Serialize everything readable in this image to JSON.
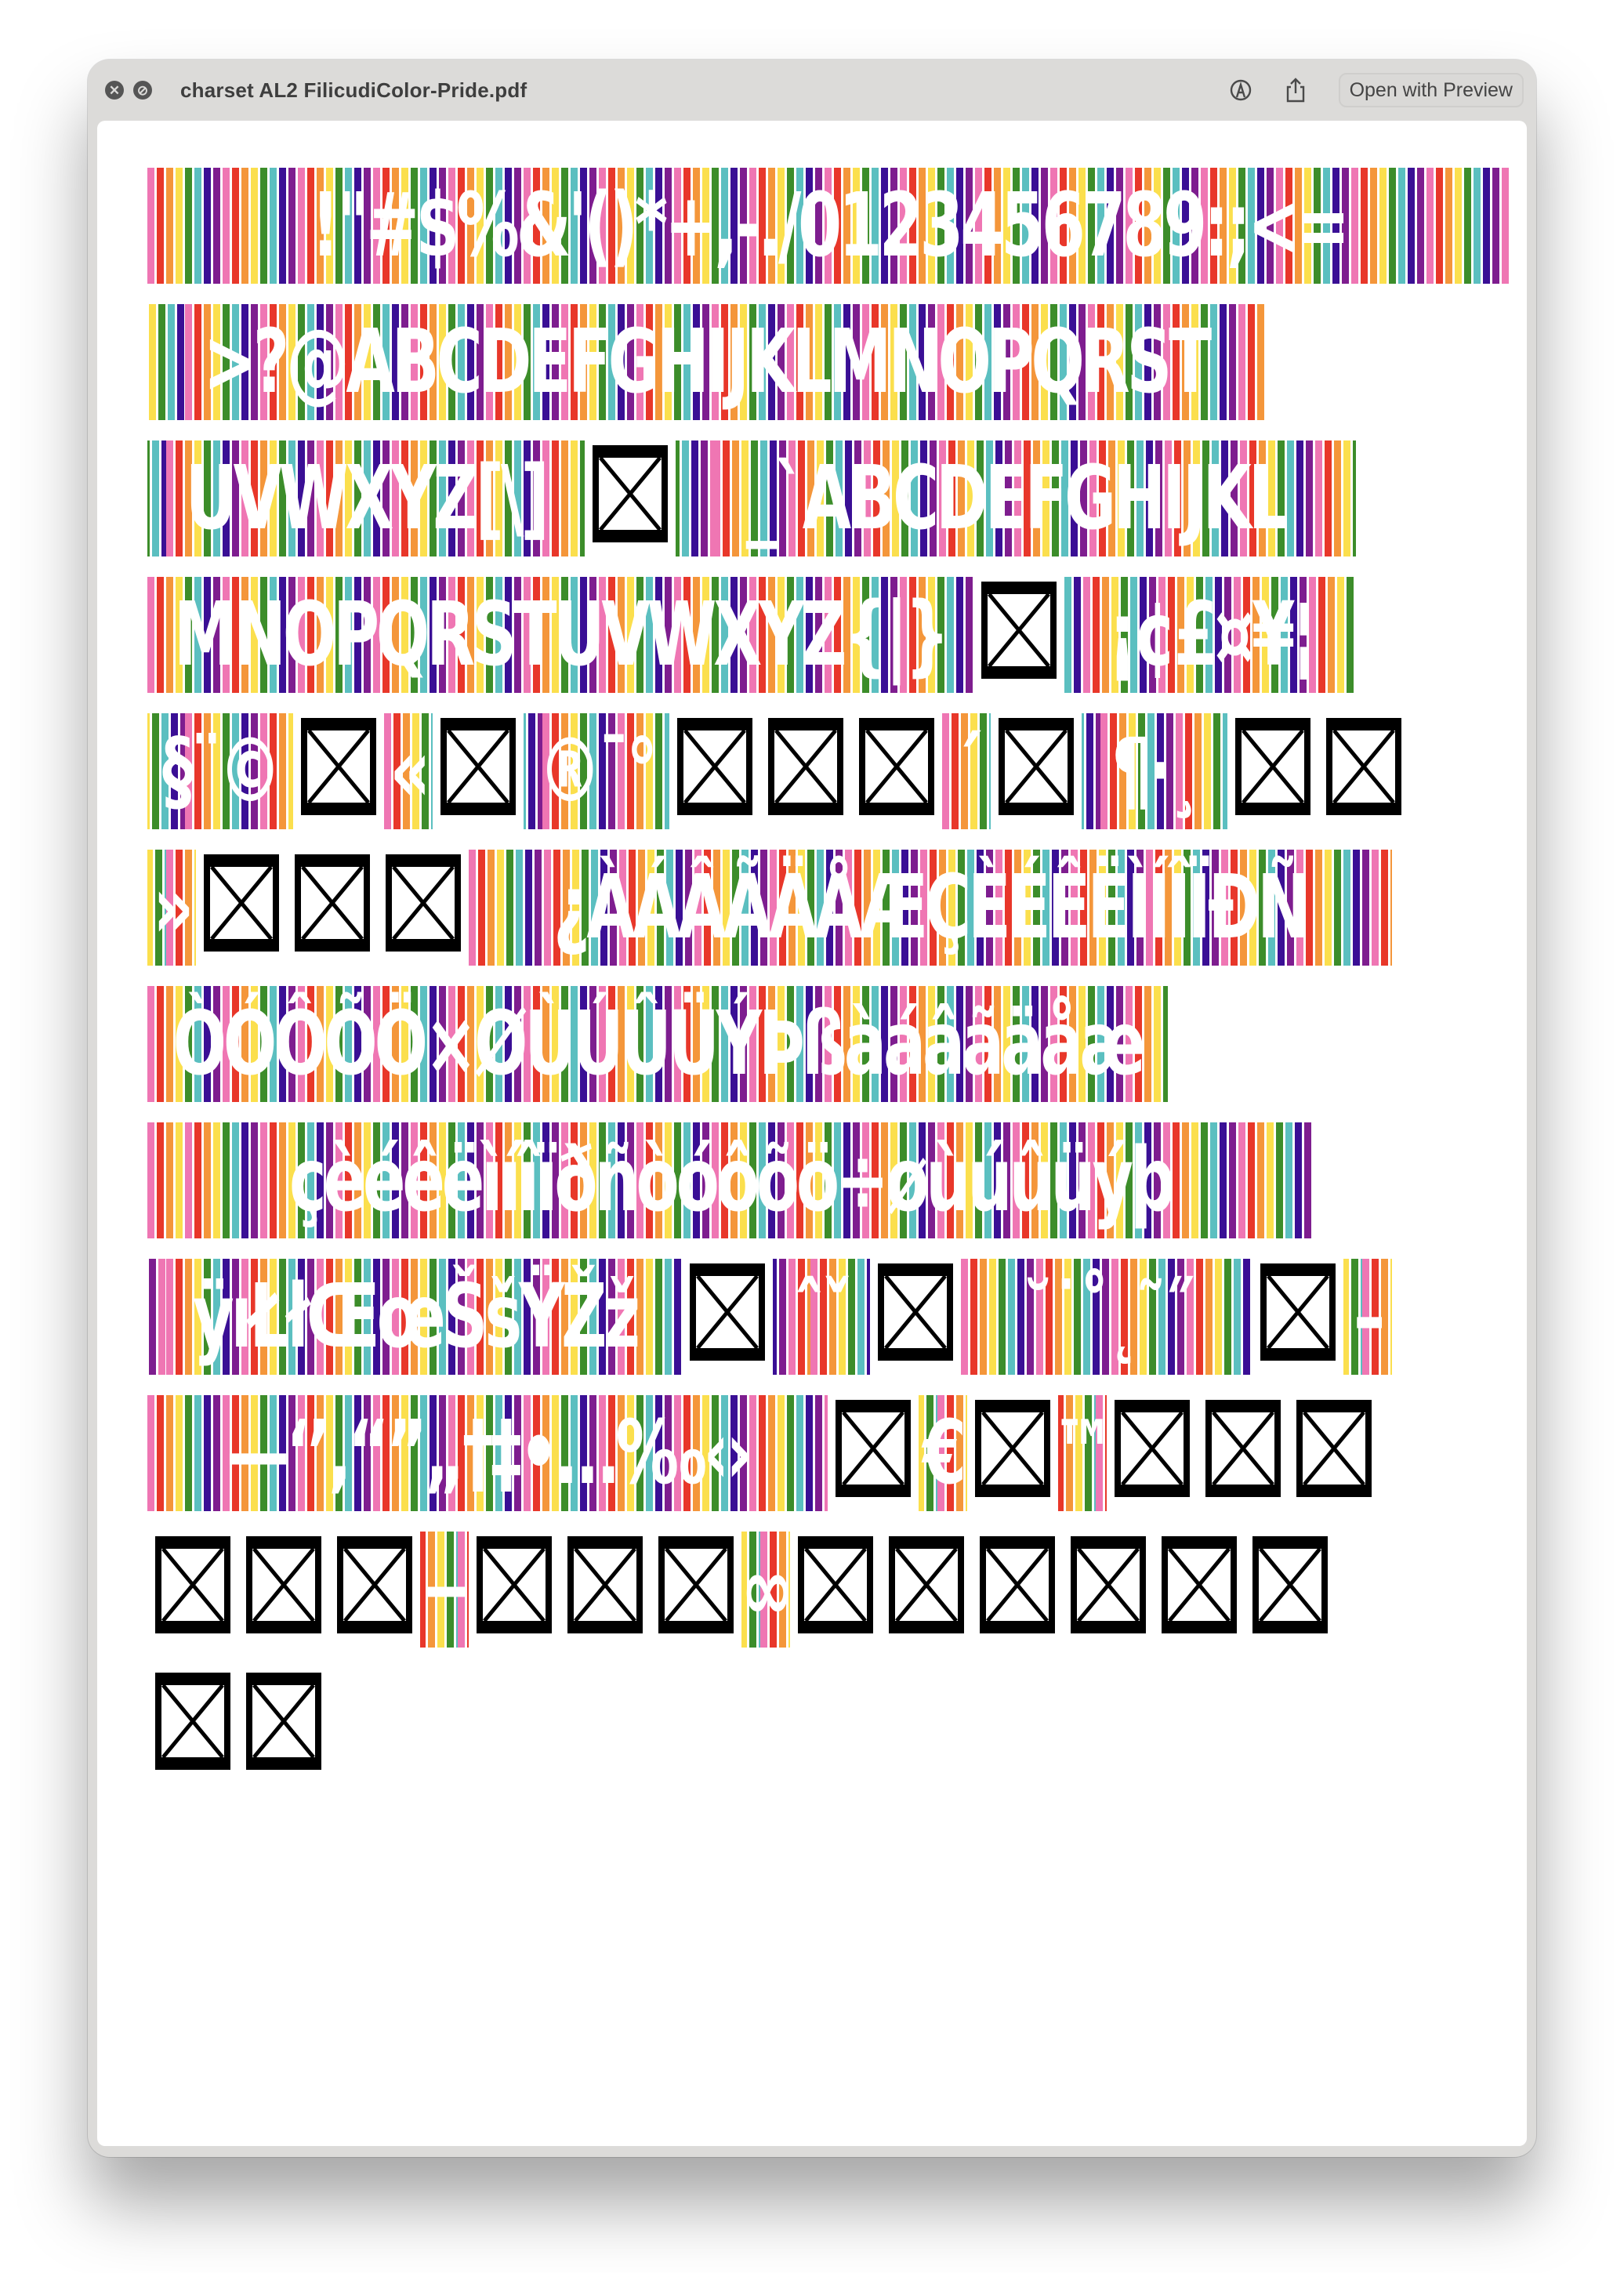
{
  "window": {
    "title": "charset AL2 FilicudiColor-Pride.pdf",
    "open_button": "Open with Preview",
    "icons": [
      "close-icon",
      "minimize-disabled-icon",
      "markup-icon",
      "share-icon"
    ]
  },
  "palette": {
    "stripes": [
      "#ef76b3",
      "#e8372a",
      "#f4963a",
      "#fbdf4d",
      "#3c8d2a",
      "#5bbfc0",
      "#3a0f95",
      "#7e1d8f"
    ],
    "glyph_fill": "#ffffff",
    "notdef_stroke": "#000000"
  },
  "document": {
    "font_name": "FilicudiColor-Pride",
    "rows": [
      {
        "segments": [
          {
            "type": "glyphs",
            "text": "!\"#$%&'()*+,-./0123456789:;<="
          }
        ]
      },
      {
        "segments": [
          {
            "type": "glyphs",
            "text": ">?@ABCDEFGHIJKLMNOPQRST"
          }
        ]
      },
      {
        "segments": [
          {
            "type": "glyphs",
            "text": "UVWXYZ[\\]"
          },
          {
            "type": "notdef"
          },
          {
            "type": "glyphs",
            "text": "_`ABCDEFGHIJKL"
          }
        ]
      },
      {
        "segments": [
          {
            "type": "glyphs",
            "text": "MNOPQRSTUVWXYZ{|}"
          },
          {
            "type": "notdef"
          },
          {
            "type": "glyphs",
            "text": "¡¢£¤¥¦"
          }
        ]
      },
      {
        "segments": [
          {
            "type": "glyphs",
            "text": "§¨©"
          },
          {
            "type": "notdef"
          },
          {
            "type": "glyphs",
            "text": "«"
          },
          {
            "type": "notdef"
          },
          {
            "type": "glyphs",
            "text": "®¯°"
          },
          {
            "type": "notdef"
          },
          {
            "type": "notdef"
          },
          {
            "type": "notdef"
          },
          {
            "type": "glyphs",
            "text": "´"
          },
          {
            "type": "notdef"
          },
          {
            "type": "glyphs",
            "text": "¶·¸"
          },
          {
            "type": "notdef"
          },
          {
            "type": "notdef"
          }
        ]
      },
      {
        "segments": [
          {
            "type": "glyphs",
            "text": "»"
          },
          {
            "type": "notdef"
          },
          {
            "type": "notdef"
          },
          {
            "type": "notdef"
          },
          {
            "type": "glyphs",
            "text": "¿ÀÁÂÃÄÅÆÇÈÉÊËÌÍÎÏÐÑ"
          }
        ]
      },
      {
        "segments": [
          {
            "type": "glyphs",
            "text": "ÒÓÔÕÖ×ØÙÚÛÜÝÞßàáâãäåæ"
          }
        ]
      },
      {
        "segments": [
          {
            "type": "glyphs",
            "text": "çèéêëìíîïðñòóôõö÷øùúûüýþ"
          }
        ]
      },
      {
        "segments": [
          {
            "type": "glyphs",
            "text": "ÿıŁłŒœŠšŸŽž"
          },
          {
            "type": "notdef"
          },
          {
            "type": "glyphs",
            "text": "ˆˇ"
          },
          {
            "type": "notdef"
          },
          {
            "type": "glyphs",
            "text": "˘˙˚˛˜˝"
          },
          {
            "type": "notdef"
          },
          {
            "type": "glyphs",
            "text": "–"
          }
        ]
      },
      {
        "segments": [
          {
            "type": "glyphs",
            "text": "—‘’‚“”„†‡•…‰‹›"
          },
          {
            "type": "notdef"
          },
          {
            "type": "glyphs",
            "text": "€"
          },
          {
            "type": "notdef"
          },
          {
            "type": "glyphs",
            "text": "™"
          },
          {
            "type": "notdef"
          },
          {
            "type": "notdef"
          },
          {
            "type": "notdef"
          }
        ]
      },
      {
        "segments": [
          {
            "type": "notdef"
          },
          {
            "type": "notdef"
          },
          {
            "type": "notdef"
          },
          {
            "type": "glyphs",
            "text": "−"
          },
          {
            "type": "notdef"
          },
          {
            "type": "notdef"
          },
          {
            "type": "notdef"
          },
          {
            "type": "glyphs",
            "text": "∞"
          },
          {
            "type": "notdef"
          },
          {
            "type": "notdef"
          },
          {
            "type": "notdef"
          },
          {
            "type": "notdef"
          },
          {
            "type": "notdef"
          },
          {
            "type": "notdef"
          }
        ]
      },
      {
        "segments": [
          {
            "type": "notdef"
          },
          {
            "type": "notdef"
          }
        ]
      }
    ]
  }
}
